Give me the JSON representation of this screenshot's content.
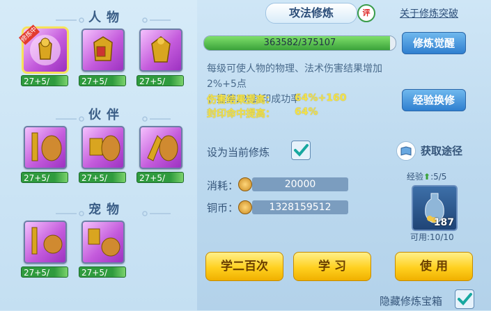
{
  "left_panel": {
    "sections": [
      {
        "title": "人物"
      },
      {
        "title": "伙伴"
      },
      {
        "title": "宠物"
      }
    ],
    "training_badge": "修炼中",
    "level_text": "27+5/",
    "level_progress": 0.72
  },
  "header": {
    "tab_title": "攻法修炼",
    "rate_label": "评",
    "about_link": "关于修炼突破"
  },
  "progress": {
    "text": "363582/375107",
    "current": 363582,
    "max": 375107
  },
  "buttons": {
    "awaken": "修炼觉醒",
    "exchange": "经验换修",
    "learn_200": "学二百次",
    "learn": "学 习",
    "use": "使 用"
  },
  "description": {
    "line1": "每级可使人物的物理、法术伤害结果增加2%+5点",
    "line2": "；提高2%封印成功率"
  },
  "effects": [
    {
      "label": "伤害结果提高：",
      "value": "64%+160"
    },
    {
      "label": "封印命中提高：",
      "value": "64%"
    }
  ],
  "set_current": {
    "label": "设为当前修炼",
    "checked": true
  },
  "obtain": {
    "label": "获取途径"
  },
  "cost": {
    "label": "消耗：",
    "value": "20000"
  },
  "copper": {
    "label": "铜币：",
    "value": "1328159512"
  },
  "item": {
    "exp_label": "经验",
    "exp_value": ":5/5",
    "count": "187",
    "usable_label": "可用:10/10"
  },
  "hide_box": {
    "label": "隐藏修炼宝箱",
    "checked": true
  },
  "colors": {
    "accent": "#2f7fd0",
    "highlight": "#f3e24a",
    "gold": "#ffd01f",
    "green": "#3aa23a"
  }
}
